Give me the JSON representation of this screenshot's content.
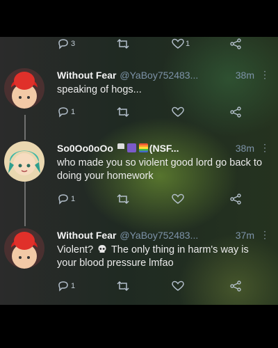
{
  "top_actions": {
    "reply_count": "3",
    "like_count": "1"
  },
  "tweets": [
    {
      "display_name": "Without Fear",
      "handle": "@YaBoy752483...",
      "time": "38m",
      "text": "speaking of hogs...",
      "reply_count": "1",
      "avatar": "red-hair-character"
    },
    {
      "display_name": "So0Oo0oOo",
      "badge": "(NSF...",
      "handle": "",
      "time": "38m",
      "text": "who made you so violent good lord go back to doing your homework",
      "reply_count": "1",
      "avatar": "teal-hair-cookie-character",
      "emojis": [
        "pennant-flag",
        "purple-heart-box",
        "rainbow-flag"
      ]
    },
    {
      "display_name": "Without Fear",
      "handle": "@YaBoy752483...",
      "time": "37m",
      "text_before_emoji": "Violent?",
      "emoji": "skull",
      "text_after_emoji": "The only thing in harm's way is your blood pressure lmfao",
      "reply_count": "1",
      "avatar": "red-hair-character"
    }
  ],
  "icons": {
    "reply": "reply-icon",
    "retweet": "retweet-icon",
    "like": "heart-icon",
    "share": "share-icon",
    "more": "more-icon"
  },
  "colors": {
    "background": "#000000",
    "handle": "#7d93a8",
    "text": "#ececec"
  }
}
